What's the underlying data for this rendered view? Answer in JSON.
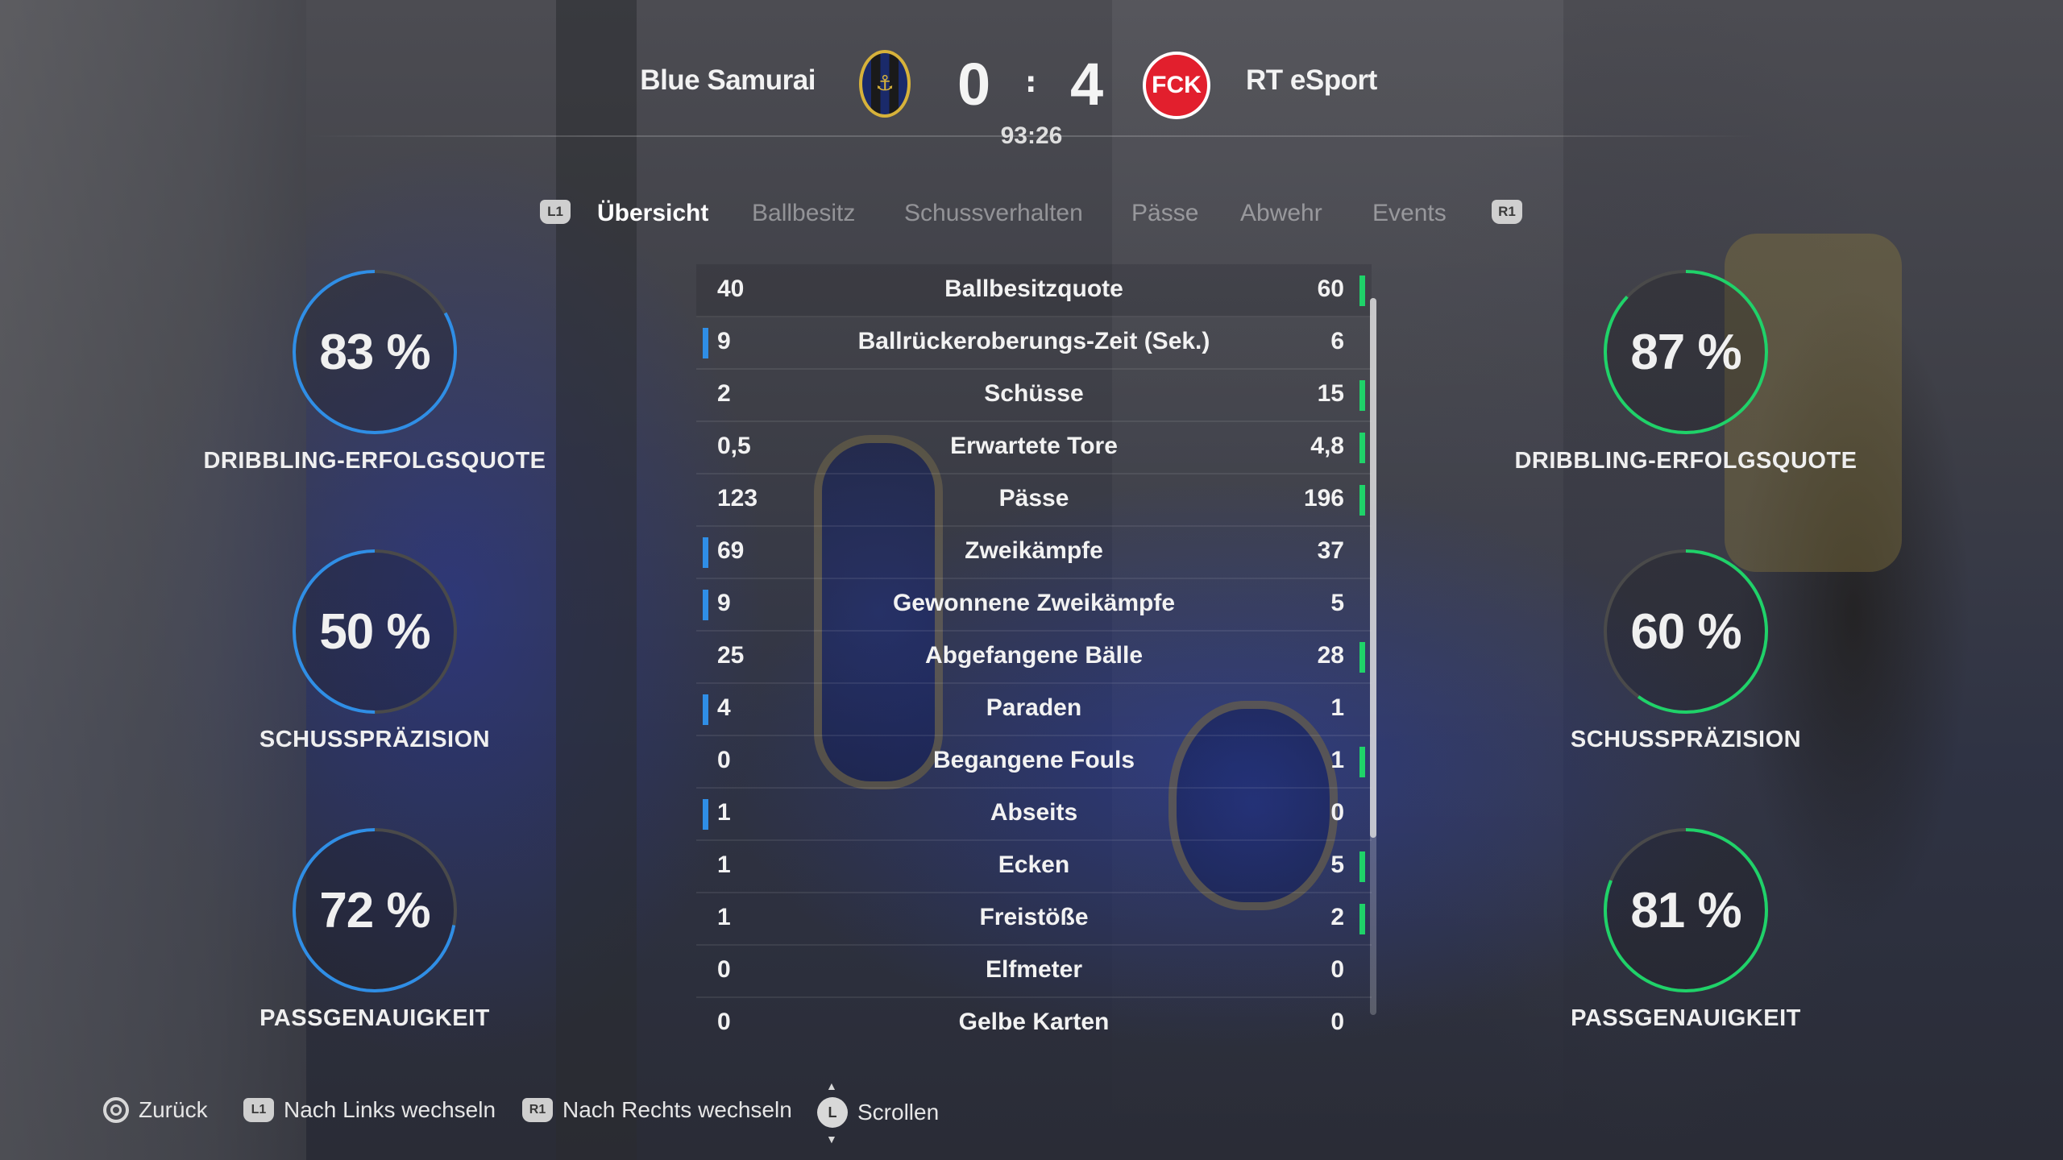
{
  "header": {
    "home_team": "Blue Samurai",
    "away_team": "RT eSport",
    "home_score": "0",
    "away_score": "4",
    "separator": ":",
    "clock": "93:26",
    "away_crest_text": "FCK"
  },
  "tabs": {
    "left_shoulder": "L1",
    "right_shoulder": "R1",
    "items": [
      "Übersicht",
      "Ballbesitz",
      "Schussverhalten",
      "Pässe",
      "Abwehr",
      "Events"
    ],
    "active": "Übersicht"
  },
  "donuts": {
    "home": [
      {
        "value": "83 %",
        "percent": 83,
        "label": "DRIBBLING-ERFOLGSQUOTE"
      },
      {
        "value": "50 %",
        "percent": 50,
        "label": "SCHUSSPRÄZISION"
      },
      {
        "value": "72 %",
        "percent": 72,
        "label": "PASSGENAUIGKEIT"
      }
    ],
    "away": [
      {
        "value": "87 %",
        "percent": 87,
        "label": "DRIBBLING-ERFOLGSQUOTE"
      },
      {
        "value": "60 %",
        "percent": 60,
        "label": "SCHUSSPRÄZISION"
      },
      {
        "value": "81 %",
        "percent": 81,
        "label": "PASSGENAUIGKEIT"
      }
    ],
    "home_color": "#2f8ee6",
    "away_color": "#1fd269",
    "track_color": "#4a4a4a"
  },
  "stats": [
    {
      "label": "Ballbesitzquote",
      "home": "40",
      "away": "60",
      "leader": "away"
    },
    {
      "label": "Ballrückeroberungs-Zeit (Sek.)",
      "home": "9",
      "away": "6",
      "leader": "home"
    },
    {
      "label": "Schüsse",
      "home": "2",
      "away": "15",
      "leader": "away"
    },
    {
      "label": "Erwartete Tore",
      "home": "0,5",
      "away": "4,8",
      "leader": "away"
    },
    {
      "label": "Pässe",
      "home": "123",
      "away": "196",
      "leader": "away"
    },
    {
      "label": "Zweikämpfe",
      "home": "69",
      "away": "37",
      "leader": "home"
    },
    {
      "label": "Gewonnene Zweikämpfe",
      "home": "9",
      "away": "5",
      "leader": "home"
    },
    {
      "label": "Abgefangene Bälle",
      "home": "25",
      "away": "28",
      "leader": "away"
    },
    {
      "label": "Paraden",
      "home": "4",
      "away": "1",
      "leader": "home"
    },
    {
      "label": "Begangene Fouls",
      "home": "0",
      "away": "1",
      "leader": "away"
    },
    {
      "label": "Abseits",
      "home": "1",
      "away": "0",
      "leader": "home"
    },
    {
      "label": "Ecken",
      "home": "1",
      "away": "5",
      "leader": "away"
    },
    {
      "label": "Freistöße",
      "home": "1",
      "away": "2",
      "leader": "away"
    },
    {
      "label": "Elfmeter",
      "home": "0",
      "away": "0",
      "leader": "none"
    },
    {
      "label": "Gelbe Karten",
      "home": "0",
      "away": "0",
      "leader": "none"
    }
  ],
  "footer": {
    "back": "Zurück",
    "left_badge": "L1",
    "left": "Nach Links wechseln",
    "right_badge": "R1",
    "right": "Nach Rechts wechseln",
    "stick_badge": "L",
    "scroll": "Scrollen"
  }
}
